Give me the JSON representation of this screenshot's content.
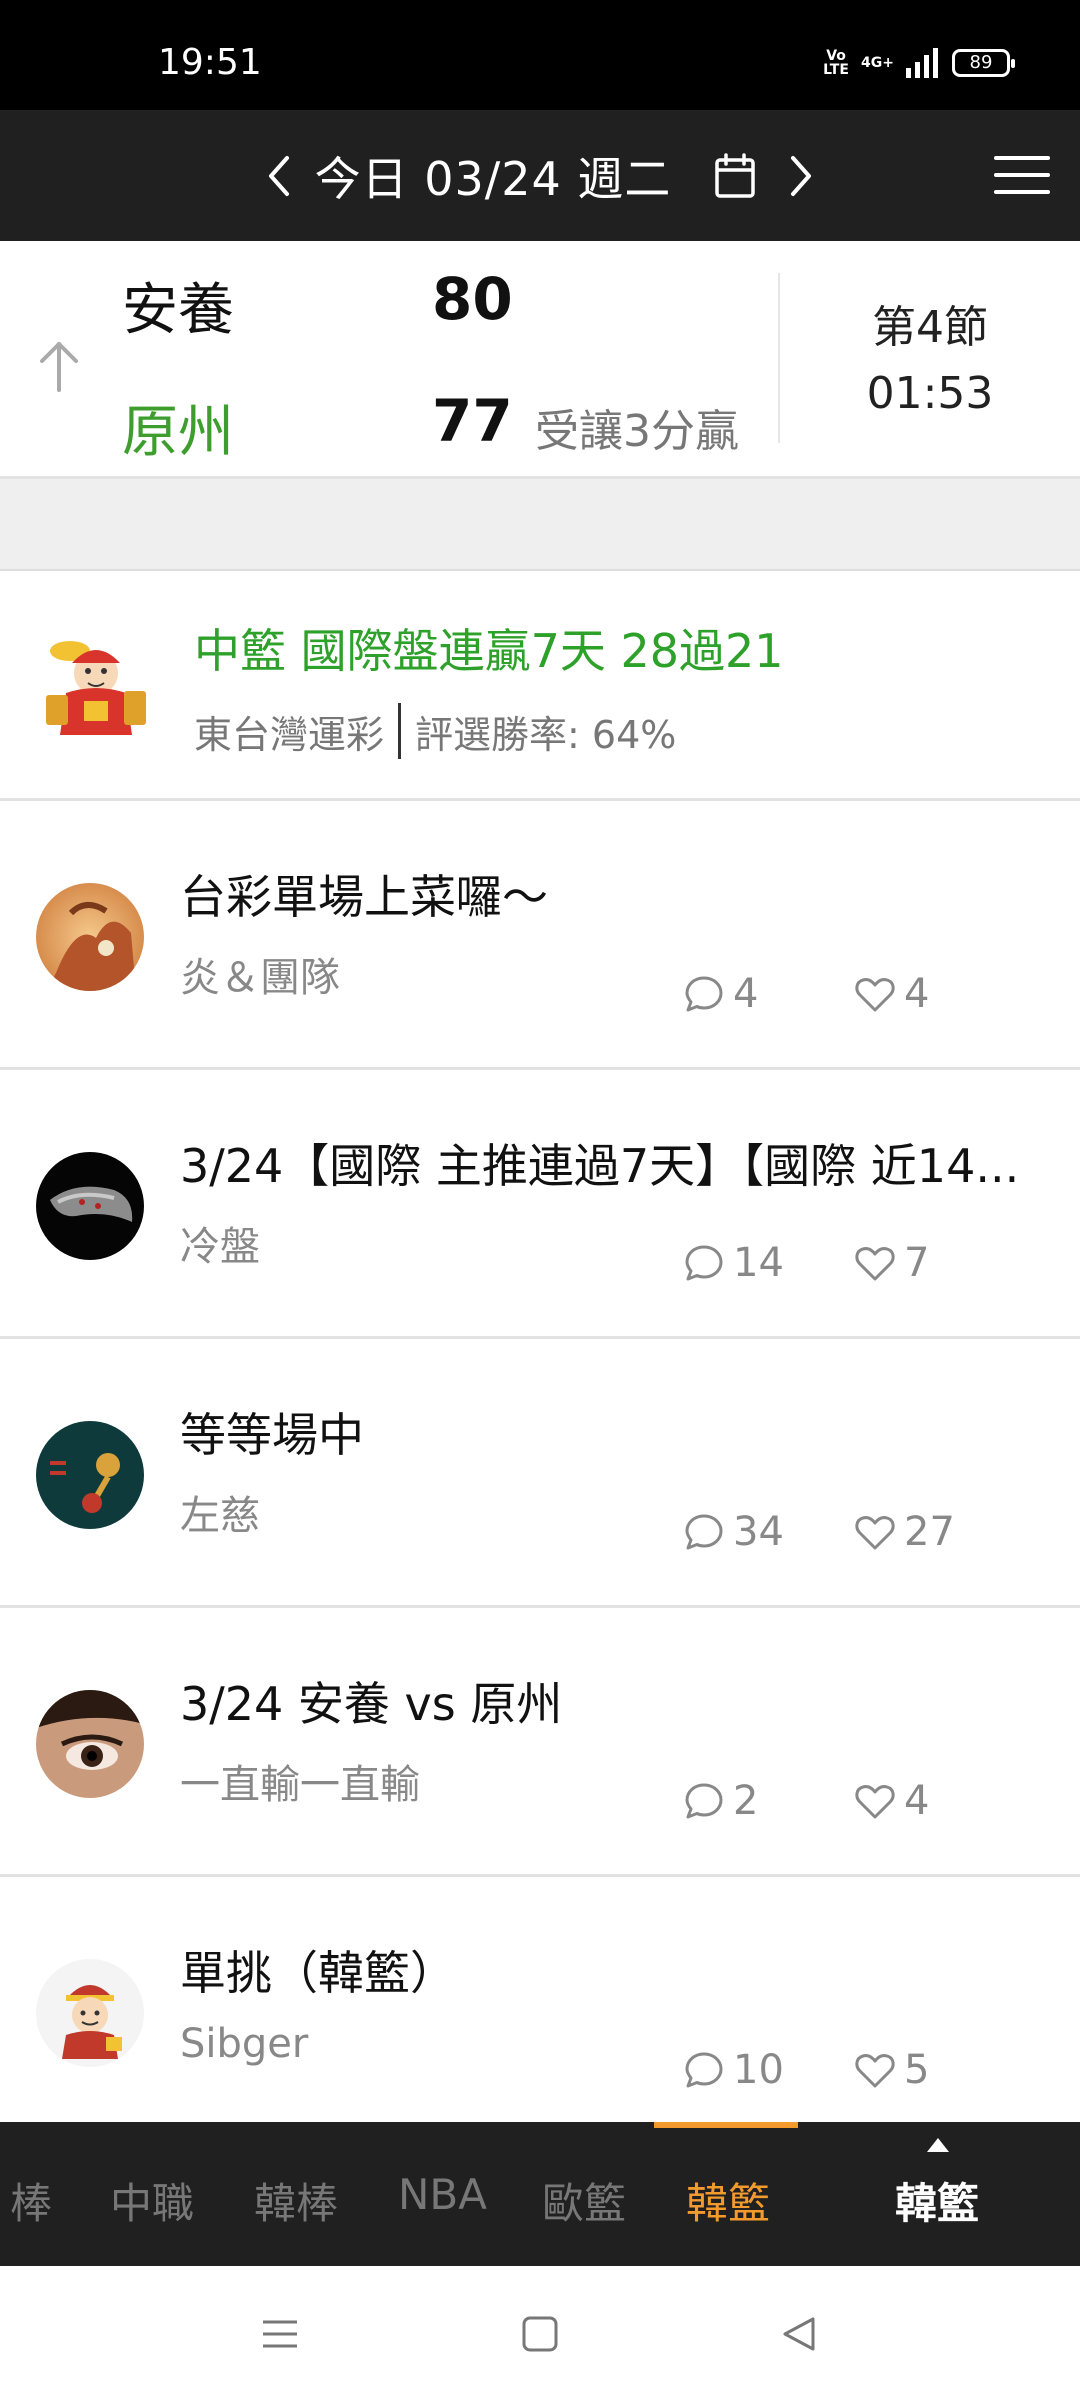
{
  "status_bar": {
    "time": "19:51",
    "volte": "Vo LTE",
    "network": "4G+",
    "battery": "89"
  },
  "header": {
    "date_label": "今日 03/24 週二",
    "icons": {
      "prev": "chevron-left-icon",
      "next": "chevron-right-icon",
      "calendar": "calendar-icon",
      "menu": "hamburger-menu-icon"
    }
  },
  "game": {
    "home_team": "安養",
    "home_score": "80",
    "away_team": "原州",
    "away_score": "77",
    "spread_result": "受讓3分贏",
    "period": "第4節",
    "clock": "01:53",
    "colors": {
      "away_team": "#3d9e2e"
    }
  },
  "ad": {
    "title": "中籃 國際盤連贏7天 28過21",
    "source": "東台灣運彩",
    "win_rate": "評選勝率: 64%",
    "colors": {
      "title": "#2ea12b"
    }
  },
  "posts": [
    {
      "title": "台彩單場上菜囉～",
      "author": "炎＆團隊",
      "comments": "4",
      "likes": "4"
    },
    {
      "title": "3/24【國際 主推連過7天】【國際 近14...",
      "author": "冷盤",
      "comments": "14",
      "likes": "7"
    },
    {
      "title": "等等場中",
      "author": "左慈",
      "comments": "34",
      "likes": "27"
    },
    {
      "title": "3/24 安養 vs 原州",
      "author": "一直輸一直輸",
      "comments": "2",
      "likes": "4"
    },
    {
      "title": "單挑（韓籃）",
      "author": "Sibger",
      "comments": "10",
      "likes": "5"
    }
  ],
  "tabs": [
    {
      "label": "棒"
    },
    {
      "label": "中職"
    },
    {
      "label": "韓棒"
    },
    {
      "label": "NBA"
    },
    {
      "label": "歐籃"
    },
    {
      "label": "韓籃",
      "active": true
    }
  ],
  "current_league": "韓籃",
  "accent_color": "#f39a2c",
  "system_nav": {
    "icons": [
      "menu-icon",
      "home-square-icon",
      "back-triangle-icon"
    ]
  }
}
